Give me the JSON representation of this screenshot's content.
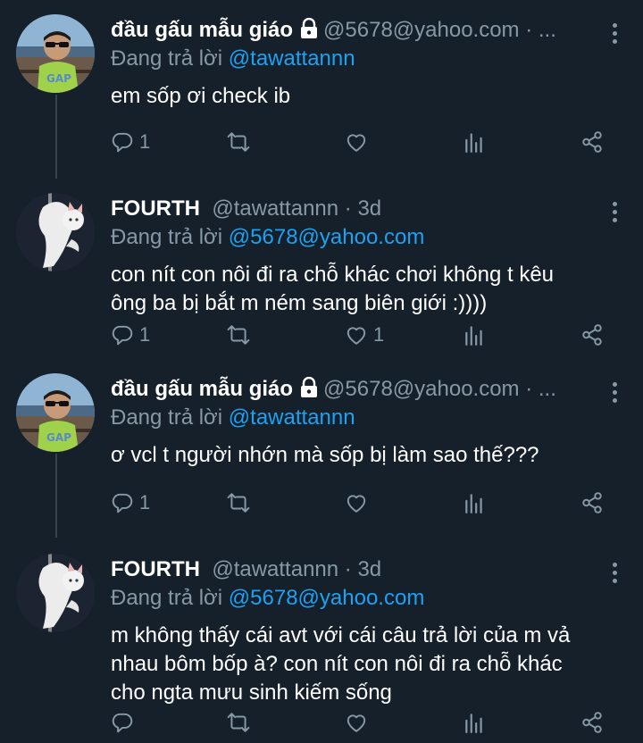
{
  "tweets": [
    {
      "name": "đầu gấu mẫu giáo",
      "handle": "@5678@yahoo.com · ...",
      "reply_prefix": "Đang trả lời ",
      "reply_to": "@tawattannn",
      "text": "em sốp ơi check ib",
      "reply_count": "1",
      "retweet_count": "",
      "like_count": "",
      "avatar": "boy-sunglasses",
      "locked": true
    },
    {
      "name": "FOURTH",
      "handle": "@tawattannn · 3d",
      "reply_prefix": "Đang trả lời ",
      "reply_to": "@5678@yahoo.com",
      "text": "con nít con nôi đi ra chỗ khác chơi không t kêu\nông ba bị bắt m ném sang biên giới :))))",
      "reply_count": "1",
      "retweet_count": "",
      "like_count": "1",
      "avatar": "white-cat",
      "locked": false
    },
    {
      "name": "đầu gấu mẫu giáo",
      "handle": "@5678@yahoo.com · ...",
      "reply_prefix": "Đang trả lời ",
      "reply_to": "@tawattannn",
      "text": "ơ vcl t người nhớn mà sốp bị làm sao thế???",
      "reply_count": "1",
      "retweet_count": "",
      "like_count": "",
      "avatar": "boy-sunglasses",
      "locked": true
    },
    {
      "name": "FOURTH",
      "handle": "@tawattannn · 3d",
      "reply_prefix": "Đang trả lời ",
      "reply_to": "@5678@yahoo.com",
      "text": "m không thấy cái avt với cái câu trả lời của m vả\nnhau bôm bốp à? con nít con nôi đi ra chỗ khác\ncho ngta mưu sinh kiếm sống",
      "reply_count": "",
      "retweet_count": "",
      "like_count": "",
      "avatar": "white-cat",
      "locked": false
    }
  ],
  "colors": {
    "background": "#15202b",
    "text": "#ffffff",
    "secondary": "#8899a6",
    "mention": "#1da1f2",
    "thread_line": "#38444d"
  },
  "icons": [
    "reply-icon",
    "retweet-icon",
    "like-icon",
    "analytics-icon",
    "share-icon",
    "lock-icon",
    "more-icon"
  ]
}
